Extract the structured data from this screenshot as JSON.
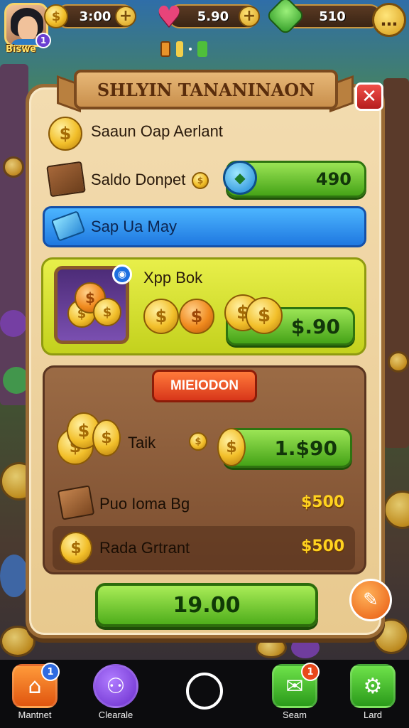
{
  "player": {
    "name": "Biswe",
    "level_badge": "1"
  },
  "resources": [
    {
      "id": "coins",
      "value": "3:00",
      "icon": "coin-icon",
      "plus": "+"
    },
    {
      "id": "hearts",
      "value": "5.90",
      "icon": "heart-icon",
      "plus": "+"
    },
    {
      "id": "gems",
      "value": "510",
      "icon": "gem-icon"
    }
  ],
  "menu_icon": "…",
  "panel": {
    "title": "SHLYIN TANANINAON",
    "close": "✕",
    "header_row": {
      "label": "Saaun Oap Aerlant",
      "coin_glyph": "$"
    },
    "deposit_row": {
      "label": "Saldo Donpet",
      "value": "490"
    },
    "blue_row": {
      "label": "Sap Ua May"
    },
    "offer": {
      "label": "Xpp Bok",
      "price": "$.90",
      "info": "◉"
    },
    "section": {
      "title": "MIEIODON",
      "rows": [
        {
          "label": "Taik",
          "price": "1.$90"
        },
        {
          "label": "Puo Ioma Bg",
          "price": "$500"
        },
        {
          "label": "Rada Grtrant",
          "price": "$500"
        }
      ]
    },
    "buy_button": "19.00",
    "action_icon": "✎"
  },
  "nav": [
    {
      "label": "Mantnet",
      "icon": "home-icon",
      "glyph": "⌂",
      "badge": "1",
      "color": "#f06a1a",
      "badge_color": "#2f6be0"
    },
    {
      "label": "Clearale",
      "icon": "chat-icon",
      "glyph": "⚇",
      "badge": "",
      "color": "#7d3fd6",
      "badge_color": "#2f6be0"
    },
    {
      "label": "Seam",
      "icon": "shop-icon",
      "glyph": "✉",
      "badge": "1",
      "color": "#3fb52e",
      "badge_color": "#e8481a"
    },
    {
      "label": "Lard",
      "icon": "settings-icon",
      "glyph": "⚙",
      "badge": "",
      "color": "#3fb52e",
      "badge_color": "#e8481a"
    }
  ]
}
